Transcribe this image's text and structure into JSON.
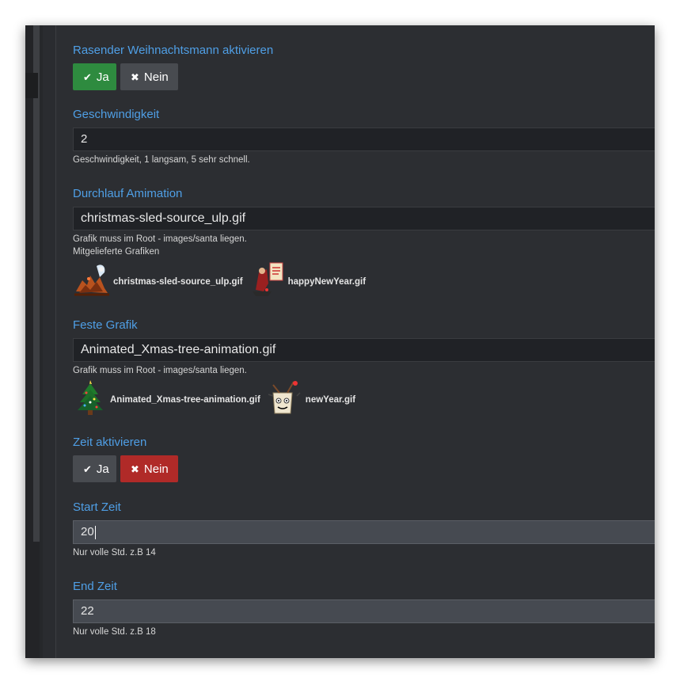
{
  "santa": {
    "label": "Rasender Weihnachtsmann aktivieren",
    "yes_label": "Ja",
    "no_label": "Nein",
    "selected": "Ja"
  },
  "speed": {
    "label": "Geschwindigkeit",
    "value": "2",
    "help": "Geschwindigkeit, 1 langsam, 5 sehr schnell."
  },
  "animation": {
    "label": "Durchlauf Amimation",
    "value": "christmas-sled-source_ulp.gif",
    "help1": "Grafik muss im Root - images/santa liegen.",
    "help2": "Mitgelieferte Grafiken",
    "images": [
      {
        "caption": "christmas-sled-source_ulp.gif",
        "icon": "sled-icon"
      },
      {
        "caption": "happyNewYear.gif",
        "icon": "new-year-banner-icon"
      }
    ]
  },
  "fixed": {
    "label": "Feste Grafik",
    "value": "Animated_Xmas-tree-animation.gif",
    "help": "Grafik muss im Root - images/santa liegen.",
    "images": [
      {
        "caption": "Animated_Xmas-tree-animation.gif",
        "icon": "xmas-tree-icon"
      },
      {
        "caption": "newYear.gif",
        "icon": "champagne-icon"
      }
    ]
  },
  "time": {
    "label": "Zeit aktivieren",
    "yes_label": "Ja",
    "no_label": "Nein",
    "selected": "Nein"
  },
  "start": {
    "label": "Start Zeit",
    "value": "20",
    "help": "Nur volle Std. z.B 14"
  },
  "end": {
    "label": "End Zeit",
    "value": "22",
    "help": "Nur volle Std. z.B 18"
  },
  "colors": {
    "accent": "#4f9fe6",
    "active_yes": "#2e8b3f",
    "active_no": "#b02a28",
    "inactive": "#484b50"
  }
}
